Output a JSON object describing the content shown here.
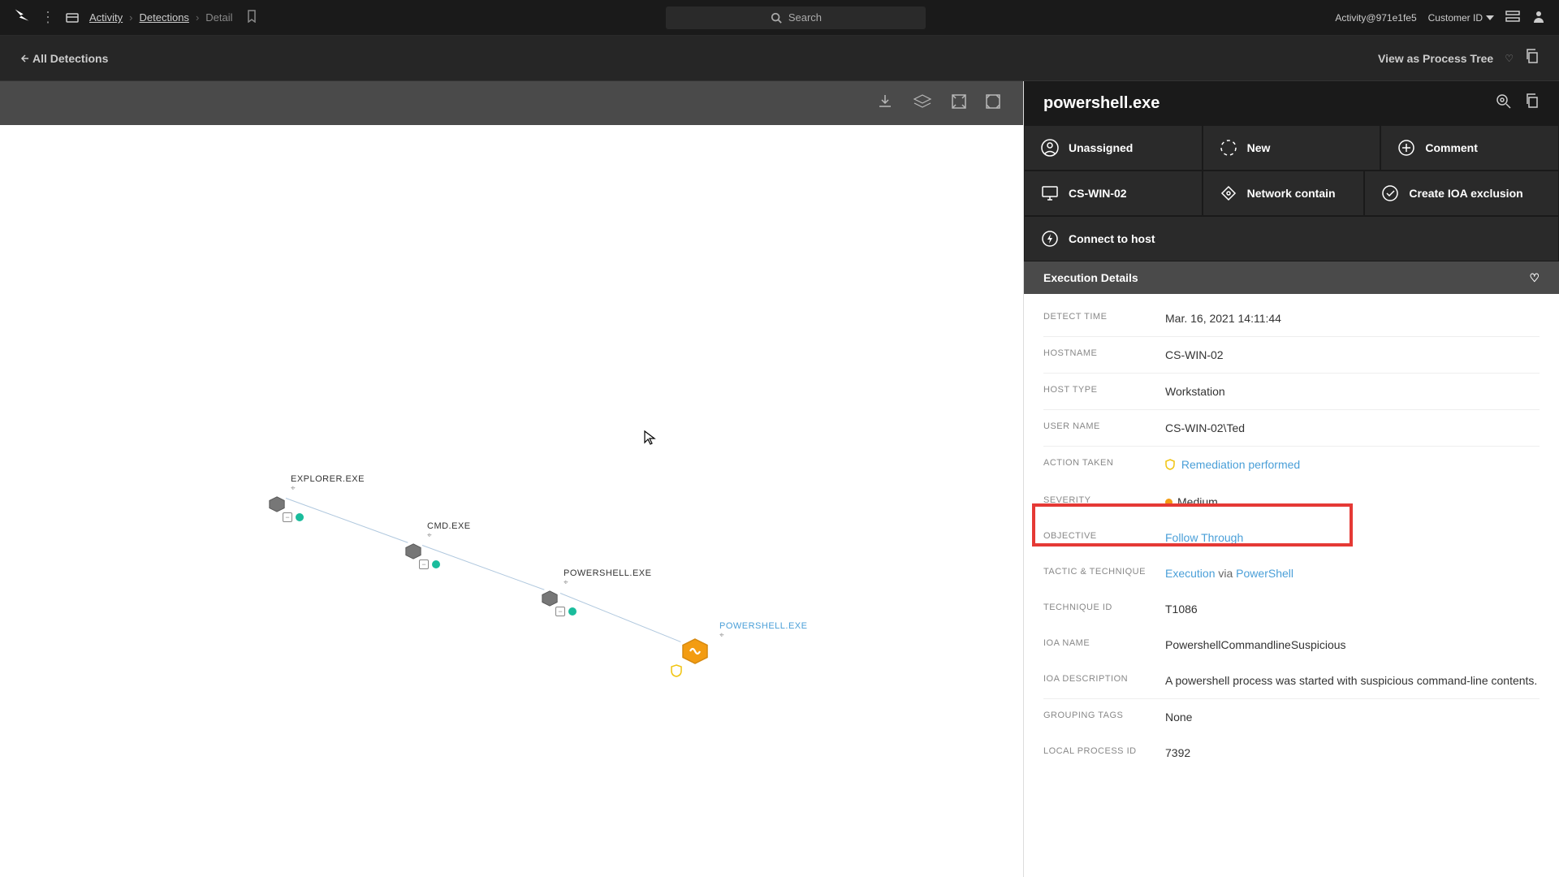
{
  "breadcrumb": {
    "l1": "Activity",
    "l2": "Detections",
    "l3": "Detail"
  },
  "search": {
    "placeholder": "Search"
  },
  "account": {
    "workspace": "Activity@971e1fe5",
    "customer_label": "Customer ID"
  },
  "subbar": {
    "back": "All Detections",
    "view_label": "View as Process Tree"
  },
  "tree": {
    "n1": "EXPLORER.EXE",
    "n2": "CMD.EXE",
    "n3": "POWERSHELL.EXE",
    "n4": "POWERSHELL.EXE"
  },
  "panel": {
    "title": "powershell.exe",
    "actions": {
      "unassigned": "Unassigned",
      "new": "New",
      "comment": "Comment",
      "host": "CS-WIN-02",
      "contain": "Network contain",
      "exclusion": "Create IOA exclusion",
      "connect": "Connect to host"
    },
    "section": "Execution Details",
    "details": {
      "detect_time_label": "DETECT TIME",
      "detect_time": "Mar. 16, 2021 14:11:44",
      "hostname_label": "HOSTNAME",
      "hostname": "CS-WIN-02",
      "host_type_label": "HOST TYPE",
      "host_type": "Workstation",
      "user_name_label": "USER NAME",
      "user_name": "CS-WIN-02\\Ted",
      "action_taken_label": "ACTION TAKEN",
      "action_taken": "Remediation performed",
      "severity_label": "SEVERITY",
      "severity": "Medium",
      "objective_label": "OBJECTIVE",
      "objective": "Follow Through",
      "tactic_label": "TACTIC & TECHNIQUE",
      "tactic": "Execution",
      "via": " via ",
      "technique": "PowerShell",
      "technique_id_label": "TECHNIQUE ID",
      "technique_id": "T1086",
      "ioa_name_label": "IOA NAME",
      "ioa_name": "PowershellCommandlineSuspicious",
      "ioa_desc_label": "IOA DESCRIPTION",
      "ioa_desc": "A powershell process was started with suspicious command-line contents.",
      "grouping_label": "GROUPING TAGS",
      "grouping": "None",
      "local_pid_label": "LOCAL PROCESS ID",
      "local_pid": "7392"
    }
  }
}
